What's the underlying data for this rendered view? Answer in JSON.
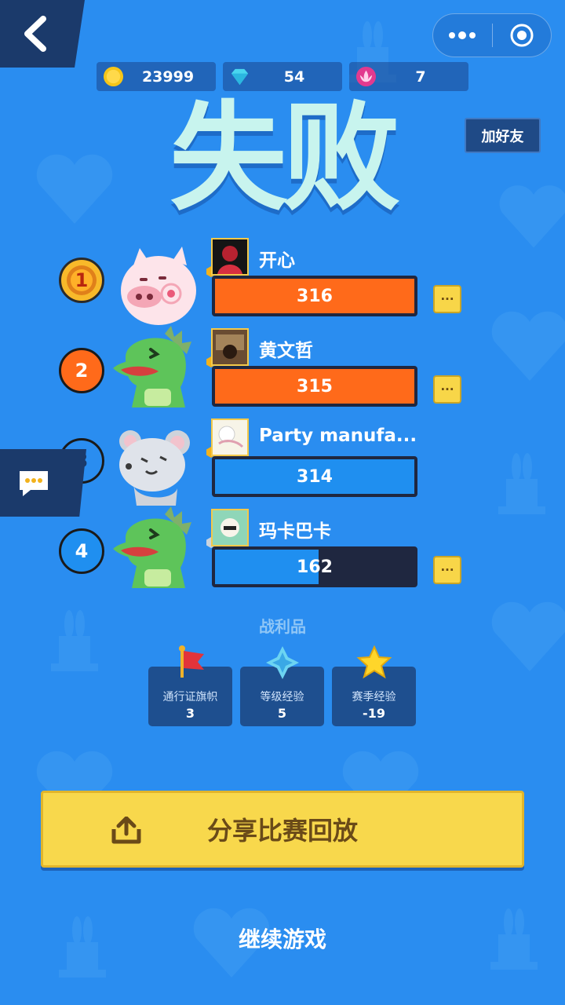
{
  "currencies": [
    {
      "icon": "gold-coin-icon",
      "value": "23999"
    },
    {
      "icon": "diamond-icon",
      "value": "54"
    },
    {
      "icon": "lotus-icon",
      "value": "7"
    }
  ],
  "title": "失败",
  "add_friend_label": "加好友",
  "players": [
    {
      "rank": "1",
      "name": "开心",
      "score": "316",
      "fill_fraction": 1.0,
      "bar_color": "#ff6a1a",
      "has_more": true
    },
    {
      "rank": "2",
      "name": "黄文哲",
      "score": "315",
      "fill_fraction": 1.0,
      "bar_color": "#ff6a1a",
      "has_more": true
    },
    {
      "rank": "3",
      "name": "Party manufa...",
      "score": "314",
      "fill_fraction": 1.0,
      "bar_color": "#1f8ff0",
      "has_more": false
    },
    {
      "rank": "4",
      "name": "玛卡巴卡",
      "score": "162",
      "fill_fraction": 0.52,
      "bar_color": "#1f8ff0",
      "has_more": true
    }
  ],
  "more_label": "···",
  "rewards_title": "战利品",
  "rewards": [
    {
      "icon": "flag-icon",
      "label": "通行证旗帜",
      "value": "3"
    },
    {
      "icon": "crystal-icon",
      "value": "5",
      "label": "等级经验"
    },
    {
      "icon": "star-icon",
      "label": "赛季经验",
      "value": "-19"
    }
  ],
  "share_label": "分享比赛回放",
  "continue_label": "继续游戏",
  "colors": {
    "background": "#2a8df0",
    "panel_dark": "#1b3a6b",
    "title": "#c8f4ee",
    "accent_yellow": "#f8d84c",
    "bar_orange": "#ff6a1a",
    "bar_blue": "#1f8ff0"
  }
}
